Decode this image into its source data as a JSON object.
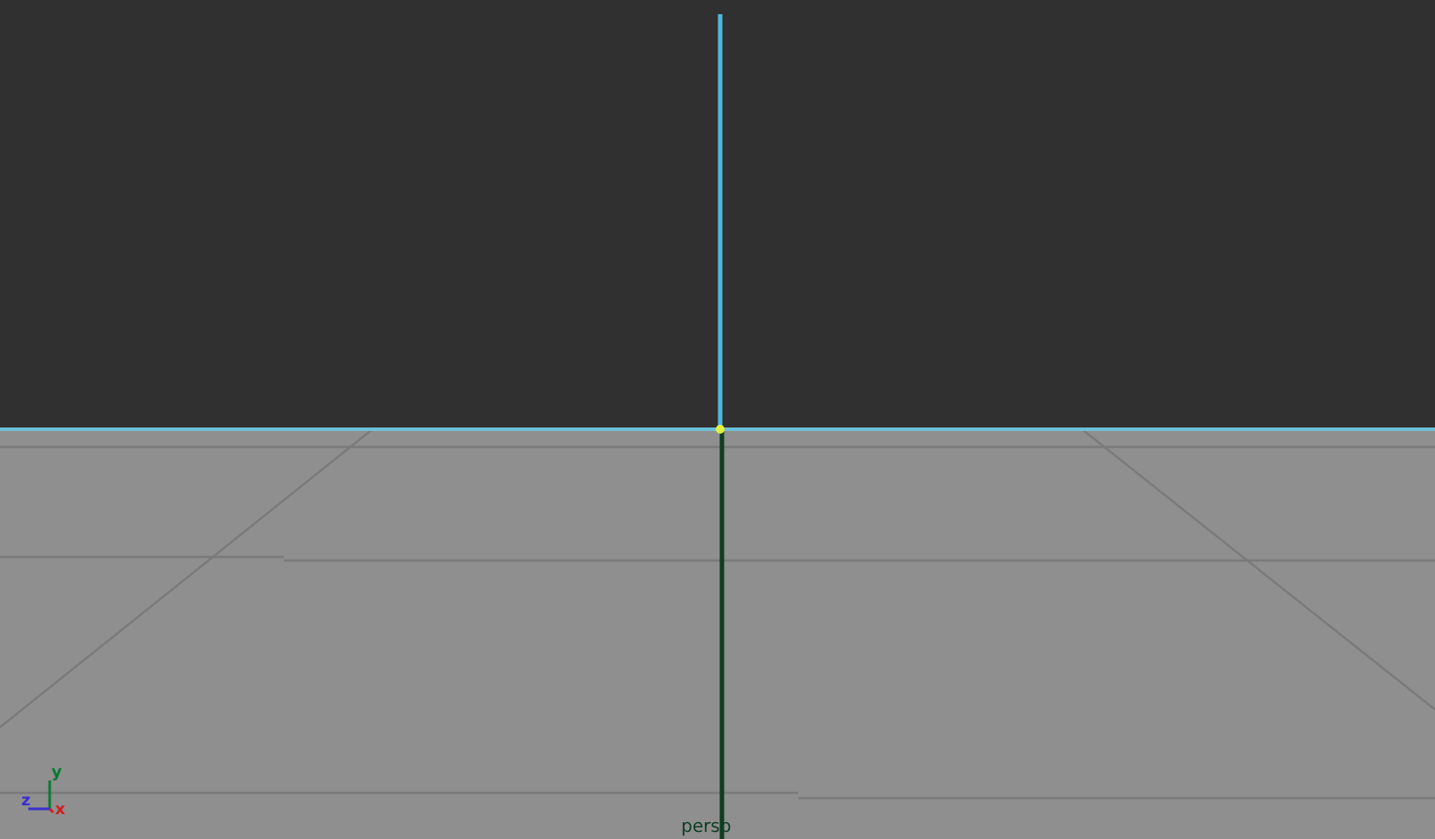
{
  "viewport": {
    "camera_label": "persp",
    "axis_labels": [
      {
        "label": "y",
        "color": "#0a7a30"
      },
      {
        "label": "z",
        "color": "#3a2fd0"
      },
      {
        "label": "x",
        "color": "#d02020"
      }
    ]
  }
}
